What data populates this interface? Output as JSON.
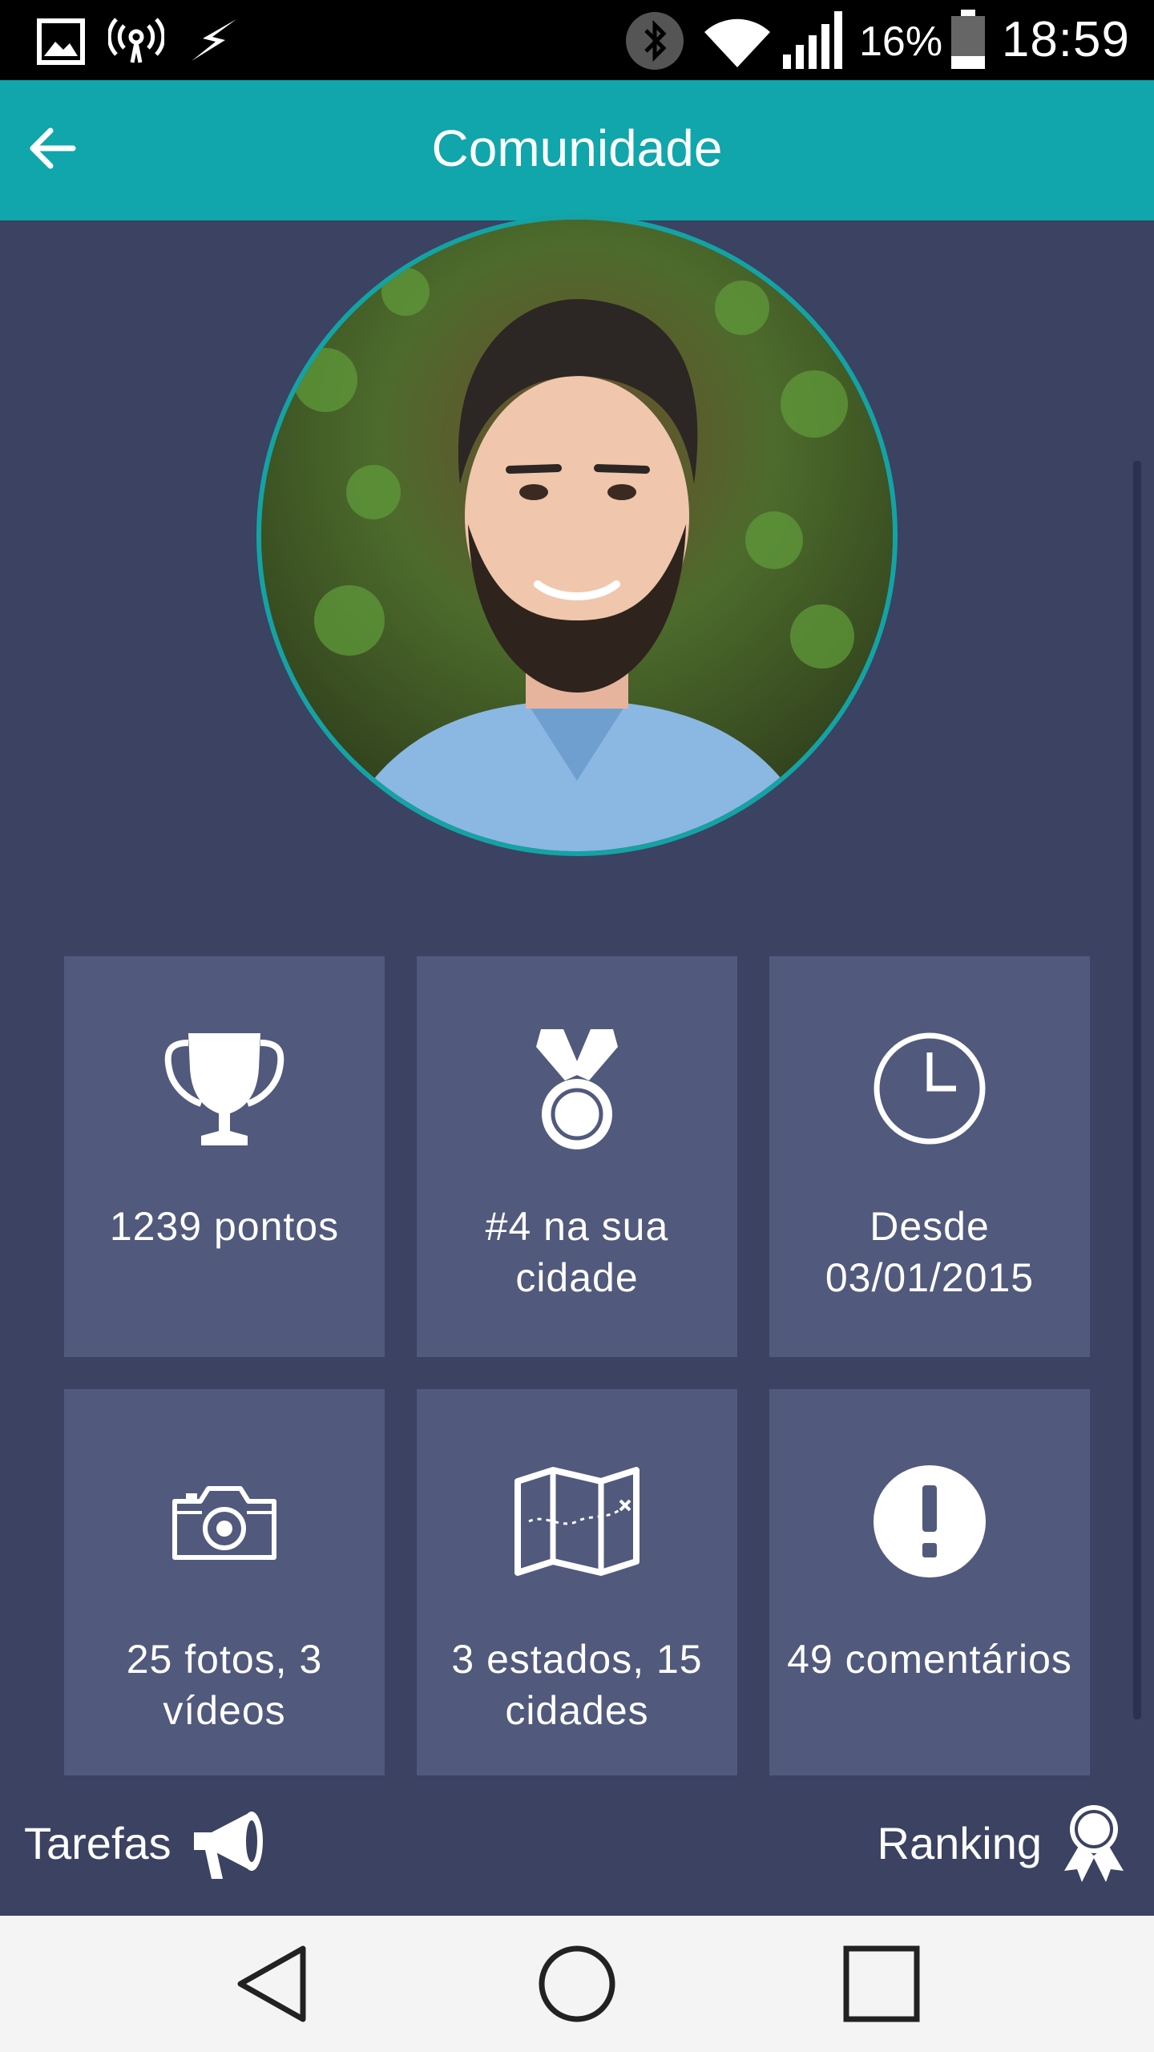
{
  "status_bar": {
    "battery_percent": "16%",
    "time": "18:59"
  },
  "header": {
    "title": "Comunidade"
  },
  "stats": [
    {
      "icon": "trophy-icon",
      "label": "1239 pontos"
    },
    {
      "icon": "medal-icon",
      "label": "#4 na sua cidade"
    },
    {
      "icon": "clock-icon",
      "label": "Desde 03/01/2015"
    },
    {
      "icon": "camera-icon",
      "label": "25 fotos, 3 vídeos"
    },
    {
      "icon": "map-icon",
      "label": "3 estados, 15 cidades"
    },
    {
      "icon": "alert-icon",
      "label": "49 comentários"
    }
  ],
  "actions": {
    "tasks_label": "Tarefas",
    "ranking_label": "Ranking"
  },
  "colors": {
    "app_bar": "#10a6ab",
    "background": "#3b4262",
    "card": "#51597d",
    "avatar_ring": "#14a3a5"
  }
}
